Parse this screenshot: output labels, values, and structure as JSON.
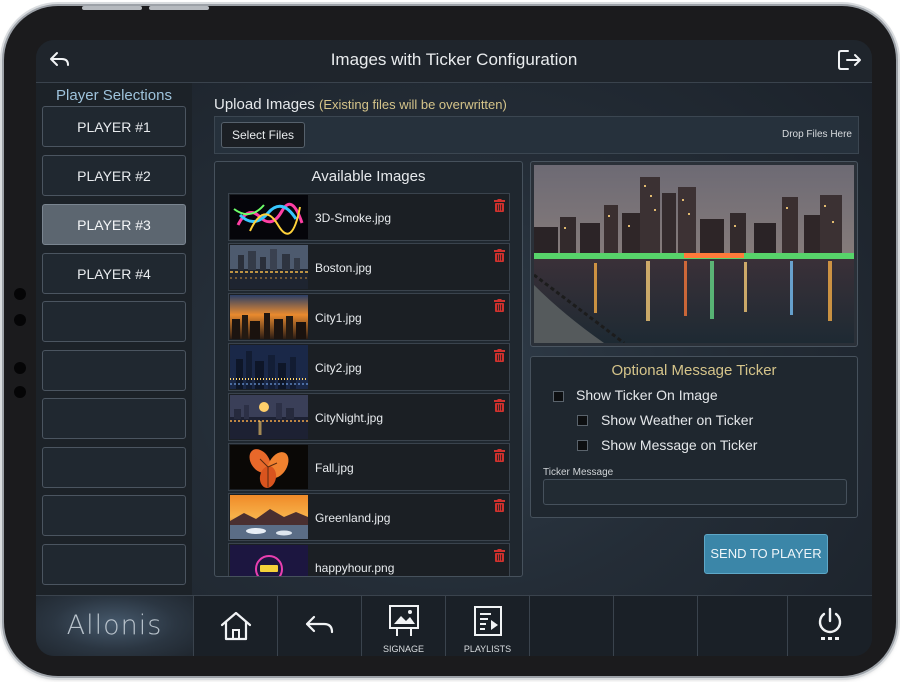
{
  "header": {
    "title": "Images with Ticker Configuration"
  },
  "sidebar": {
    "heading": "Player Selections",
    "players": [
      "PLAYER #1",
      "PLAYER #2",
      "PLAYER #3",
      "PLAYER #4"
    ],
    "active_player": "PLAYER #3"
  },
  "upload": {
    "label": "Upload Images",
    "note": "(Existing files will be overwritten)",
    "select_button": "Select Files",
    "drop_text": "Drop Files Here"
  },
  "available_images": {
    "heading": "Available Images",
    "files": [
      "3D-Smoke.jpg",
      "Boston.jpg",
      "City1.jpg",
      "City2.jpg",
      "CityNight.jpg",
      "Fall.jpg",
      "Greenland.jpg",
      "happyhour.png"
    ]
  },
  "ticker": {
    "heading": "Optional Message Ticker",
    "show_on_image": "Show Ticker On Image",
    "show_weather": "Show Weather on Ticker",
    "show_message": "Show Message on Ticker",
    "message_label": "Ticker Message",
    "message_value": ""
  },
  "send_button": "SEND TO PLAYER",
  "bottom_bar": {
    "logo": "Allonis",
    "signage": "SIGNAGE",
    "playlists": "PLAYLISTS"
  },
  "colors": {
    "accent_blue": "#3b86a8",
    "gold_text": "#d5c48a",
    "heading_blue": "#9ec3dc",
    "trash_red": "#d0312d"
  },
  "icons": [
    "back-arrow-icon",
    "logout-icon",
    "trash-icon",
    "home-icon",
    "undo-arrow-icon",
    "signage-icon",
    "playlist-icon",
    "power-icon"
  ]
}
